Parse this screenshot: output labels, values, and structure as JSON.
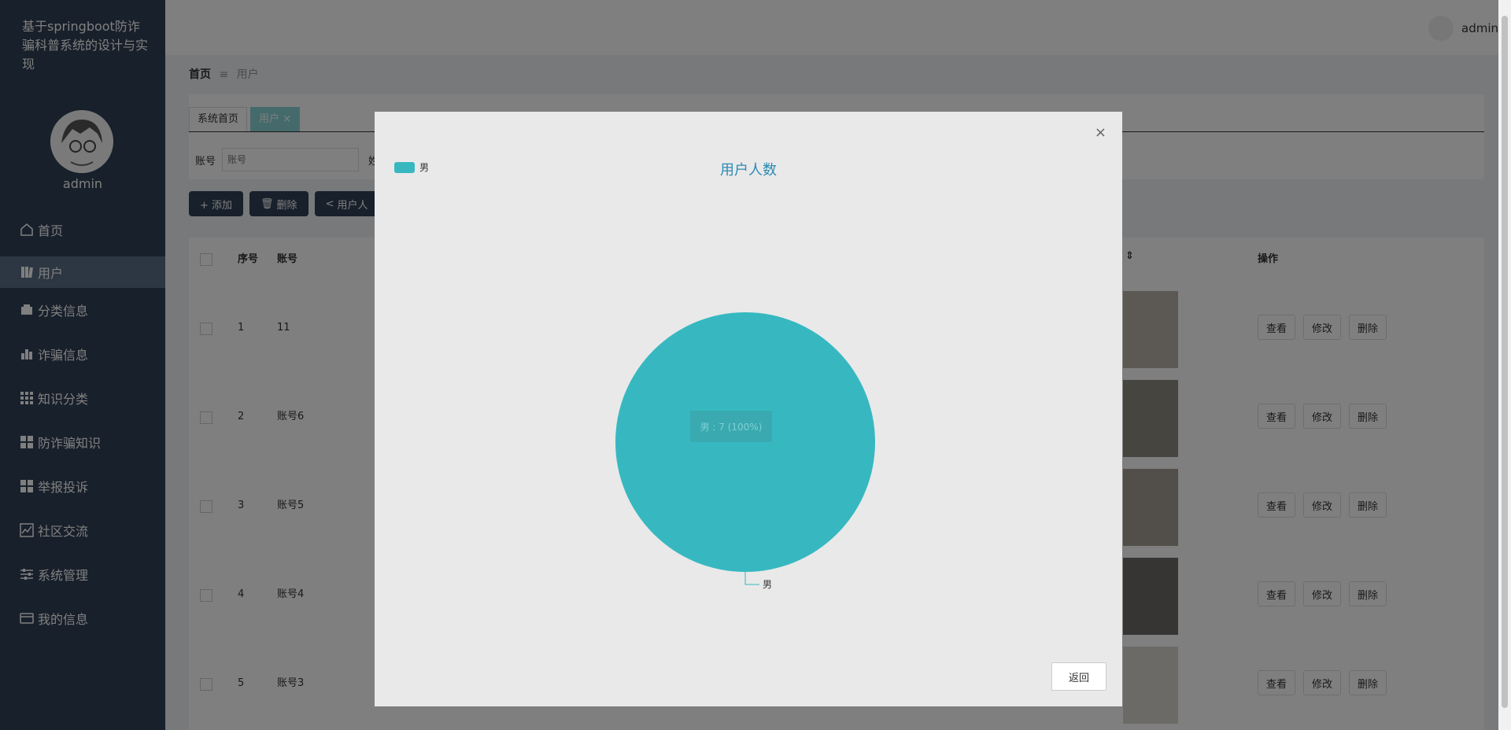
{
  "sidebar": {
    "app_title": "基于springboot防诈骗科普系统的设计与实现",
    "user_name": "admin",
    "items": [
      {
        "label": "首页",
        "icon": "home-icon"
      },
      {
        "label": "用户",
        "icon": "book-icon"
      },
      {
        "label": "分类信息",
        "icon": "wallet-icon"
      },
      {
        "label": "诈骗信息",
        "icon": "bar-chart-icon"
      },
      {
        "label": "知识分类",
        "icon": "grid-icon"
      },
      {
        "label": "防诈骗知识",
        "icon": "apps-icon"
      },
      {
        "label": "举报投诉",
        "icon": "apps-icon"
      },
      {
        "label": "社区交流",
        "icon": "line-chart-icon"
      },
      {
        "label": "系统管理",
        "icon": "sliders-icon"
      },
      {
        "label": "我的信息",
        "icon": "card-icon"
      }
    ]
  },
  "topbar": {
    "user_name": "admin"
  },
  "breadcrumb": {
    "home": "首页",
    "separator": "≡",
    "current": "用户"
  },
  "tabs": [
    {
      "label": "系统首页"
    },
    {
      "label": "用户 ×"
    }
  ],
  "search": {
    "account_label": "账号",
    "account_placeholder": "账号",
    "second_label": "姓"
  },
  "buttons": {
    "add": "+ 添加",
    "delete": "删除",
    "user_stats": "用户人"
  },
  "table": {
    "headers": {
      "index": "序号",
      "account": "账号",
      "photo_sort": "⇕",
      "ops": "操作"
    },
    "rows": [
      {
        "index": "1",
        "account": "11"
      },
      {
        "index": "2",
        "account": "账号6"
      },
      {
        "index": "3",
        "account": "账号5"
      },
      {
        "index": "4",
        "account": "账号4"
      },
      {
        "index": "5",
        "account": "账号3"
      }
    ],
    "op_view": "查看",
    "op_edit": "修改",
    "op_delete": "删除"
  },
  "dialog": {
    "close": "×",
    "back_label": "返回"
  },
  "chart_data": {
    "type": "pie",
    "title": "用户人数",
    "series": [
      {
        "name": "男",
        "values": [
          7
        ]
      }
    ],
    "categories": [
      "男"
    ],
    "data_label": "男 : 7 (100%)",
    "legend_position": "top-left",
    "colors": [
      "#37b8c0"
    ]
  }
}
